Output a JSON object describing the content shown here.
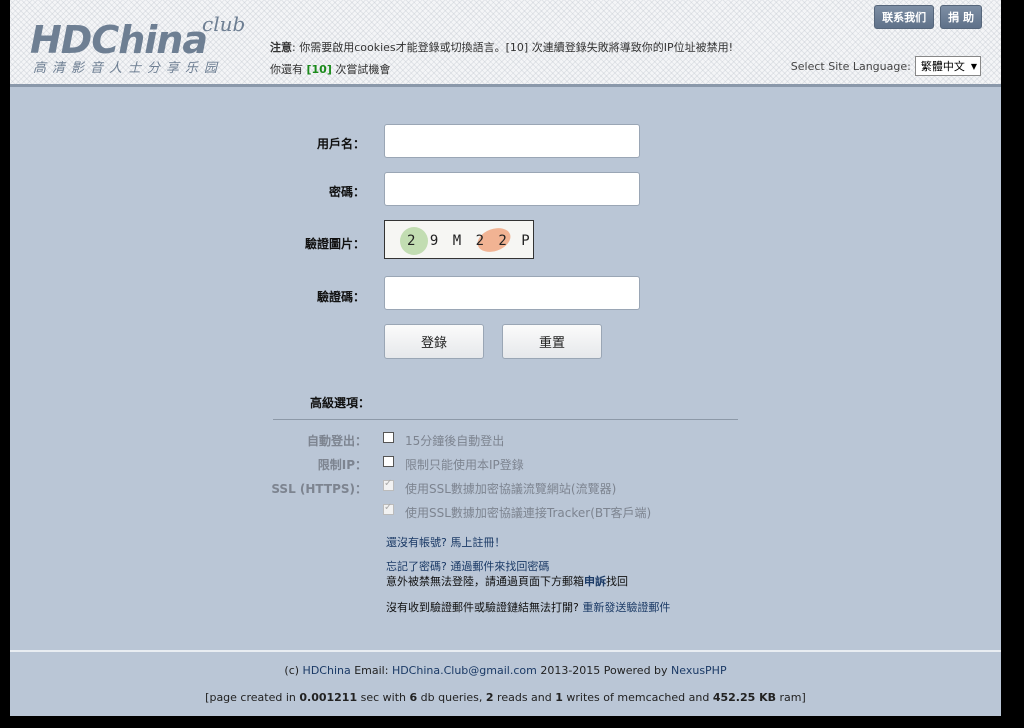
{
  "header": {
    "logo": {
      "word": "HDChina",
      "club": "club",
      "sub": "高清影音人士分享乐园"
    },
    "notice_label": "注意",
    "notice_text": ": 你需要啟用cookies才能登錄或切換語言。[10] 次連續登錄失敗將導致你的IP位址被禁用!",
    "attempts_prefix": "你還有 ",
    "attempts_count": "[10]",
    "attempts_suffix": " 次嘗試機會",
    "contact_button": "联系我们",
    "donate_button": "捐 助",
    "lang_label": "Select Site Language:",
    "lang_selected": "繁體中文"
  },
  "form": {
    "username_label": "用戶名：",
    "password_label": "密碼：",
    "captcha_image_label": "驗證圖片：",
    "captcha_text": "29M22P",
    "captcha_code_label": "驗證碼：",
    "login_button": "登錄",
    "reset_button": "重置"
  },
  "advanced": {
    "title": "高級選項：",
    "options": [
      {
        "label": "自動登出：",
        "text": "15分鐘後自動登出",
        "checked": false
      },
      {
        "label": "限制IP：",
        "text": "限制只能使用本IP登錄",
        "checked": false
      },
      {
        "label": "SSL (HTTPS)：",
        "text": "使用SSL數據加密協議流覽網站(流覽器)",
        "checked": true
      },
      {
        "label": "",
        "text": "使用SSL數據加密協議連接Tracker(BT客戶端)",
        "checked": true
      }
    ]
  },
  "links": {
    "signup": "還沒有帳號? 馬上註冊！",
    "forgot": "忘記了密碼? 通過郵件來找回密碼",
    "banned_prefix": "意外被禁無法登陸，請通過頁面下方郵箱",
    "banned_bold": "申訴",
    "banned_suffix": "找回",
    "resend_prefix": "沒有收到驗證郵件或驗證鏈結無法打開? ",
    "resend_link": "重新發送驗證郵件"
  },
  "footer": {
    "copyright_prefix": "(c) ",
    "site_name": "HDChina",
    "email_label": " Email: ",
    "email": "HDChina.Club@gmail.com",
    "years_powered": " 2013-2015 Powered by ",
    "powered_by": "NexusPHP",
    "stats_1": "[page created in ",
    "time": "0.001211",
    "stats_2": " sec with ",
    "queries": "6",
    "stats_3": " db queries, ",
    "reads": "2",
    "stats_4": " reads and ",
    "writes": "1",
    "stats_5": " writes of memcached and ",
    "ram": "452.25 KB",
    "stats_6": " ram]"
  }
}
